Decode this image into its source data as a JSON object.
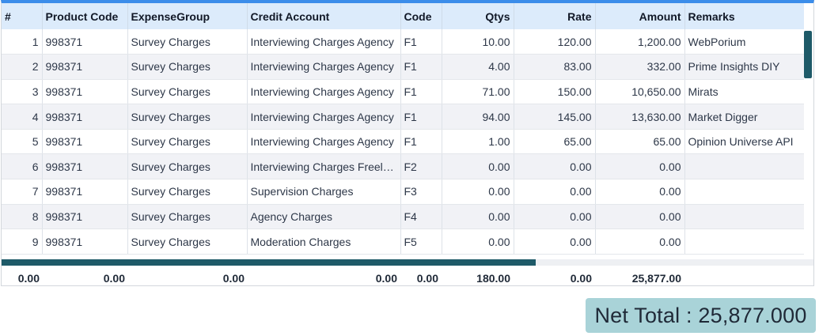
{
  "grid": {
    "columns": [
      "#",
      "Product Code",
      "ExpenseGroup",
      "Credit Account",
      "Code",
      "Qtys",
      "Rate",
      "Amount",
      "Remarks"
    ],
    "rows": [
      {
        "idx": "1",
        "product_code": "998371",
        "expense_group": "Survey Charges",
        "credit_account": "Interviewing Charges Agency",
        "code": "F1",
        "qtys": "10.00",
        "rate": "120.00",
        "amount": "1,200.00",
        "remarks": "WebPorium"
      },
      {
        "idx": "2",
        "product_code": "998371",
        "expense_group": "Survey Charges",
        "credit_account": "Interviewing Charges Agency",
        "code": "F1",
        "qtys": "4.00",
        "rate": "83.00",
        "amount": "332.00",
        "remarks": "Prime Insights DIY"
      },
      {
        "idx": "3",
        "product_code": "998371",
        "expense_group": "Survey Charges",
        "credit_account": "Interviewing Charges Agency",
        "code": "F1",
        "qtys": "71.00",
        "rate": "150.00",
        "amount": "10,650.00",
        "remarks": "Mirats"
      },
      {
        "idx": "4",
        "product_code": "998371",
        "expense_group": "Survey Charges",
        "credit_account": "Interviewing Charges Agency",
        "code": "F1",
        "qtys": "94.00",
        "rate": "145.00",
        "amount": "13,630.00",
        "remarks": "Market Digger"
      },
      {
        "idx": "5",
        "product_code": "998371",
        "expense_group": "Survey Charges",
        "credit_account": "Interviewing Charges Agency",
        "code": "F1",
        "qtys": "1.00",
        "rate": "65.00",
        "amount": "65.00",
        "remarks": "Opinion Universe API"
      },
      {
        "idx": "6",
        "product_code": "998371",
        "expense_group": "Survey Charges",
        "credit_account": "Interviewing Charges Freela...",
        "code": "F2",
        "qtys": "0.00",
        "rate": "0.00",
        "amount": "0.00",
        "remarks": ""
      },
      {
        "idx": "7",
        "product_code": "998371",
        "expense_group": "Survey Charges",
        "credit_account": "Supervision Charges",
        "code": "F3",
        "qtys": "0.00",
        "rate": "0.00",
        "amount": "0.00",
        "remarks": ""
      },
      {
        "idx": "8",
        "product_code": "998371",
        "expense_group": "Survey Charges",
        "credit_account": "Agency Charges",
        "code": "F4",
        "qtys": "0.00",
        "rate": "0.00",
        "amount": "0.00",
        "remarks": ""
      },
      {
        "idx": "9",
        "product_code": "998371",
        "expense_group": "Survey Charges",
        "credit_account": "Moderation Charges",
        "code": "F5",
        "qtys": "0.00",
        "rate": "0.00",
        "amount": "0.00",
        "remarks": ""
      }
    ]
  },
  "footer": {
    "values": [
      "0.00",
      "0.00",
      "0.00",
      "0.00",
      "0.00",
      "180.00",
      "0.00",
      "25,877.00"
    ]
  },
  "net_total": {
    "text": "Net Total : 25,877.000"
  },
  "colors": {
    "header_accent": "#3b8dea",
    "header_bg": "#dcebfb",
    "scrollbar": "#1e5a68",
    "net_total_bg": "#a9d3d8"
  }
}
